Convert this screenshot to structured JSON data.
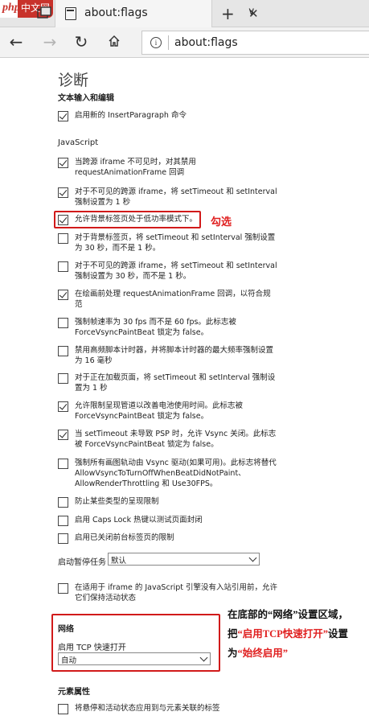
{
  "browser": {
    "logo_text": "php",
    "logo_cn": "中文网",
    "tab_title": "about:flags",
    "tab_close": "✕",
    "new_tab": "+",
    "tab_menu": "∨",
    "address": "about:flags",
    "back": "←",
    "forward": "→",
    "refresh": "↻"
  },
  "page": {
    "heading": "诊断",
    "sections": {
      "text_input": "文本输入和编辑",
      "javascript": "JavaScript",
      "startup_label": "启动暂停任务",
      "network": "网络",
      "tcp_label": "启用 TCP 快速打开",
      "element_props": "元素属性"
    },
    "options": [
      {
        "label": "启用新的 InsertParagraph 命令",
        "checked": true
      },
      {
        "label": "当跨源 iframe 不可见时，对其禁用 requestAnimationFrame 回调",
        "checked": true
      },
      {
        "label": "对于不可见的跨源 iframe，将 setTimeout 和 setInterval 强制设置为 1 秒",
        "checked": true
      },
      {
        "label": "允许背景标签页处于低功率模式下。",
        "checked": true
      },
      {
        "label": "对于背景标签页，将 setTimeout 和 setInterval 强制设置为 30 秒，而不是 1 秒。",
        "checked": false
      },
      {
        "label": "对于不可见的跨源 iframe，将 setTimeout 和 setInterval 强制设置为 30 秒，而不是 1 秒。",
        "checked": false
      },
      {
        "label": "在绘画前处理 requestAnimationFrame 回调，以符合规范",
        "checked": true
      },
      {
        "label": "强制帧速率为 30 fps 而不是 60 fps。此标志被 ForceVsyncPaintBeat 锁定为 false。",
        "checked": false
      },
      {
        "label": "禁用高频脚本计时器，并将脚本计时器的最大频率强制设置为 16 毫秒",
        "checked": false
      },
      {
        "label": "对于正在加载页面，将 setTimeout 和 setInterval 强制设置为 1 秒",
        "checked": false
      },
      {
        "label": "允许限制呈现管道以改善电池使用时间。此标志被 ForceVsyncPaintBeat 锁定为 false。",
        "checked": true
      },
      {
        "label": "当 setTimeout 未导致 PSP 时，允许 Vsync 关闭。此标志被 ForceVsyncPaintBeat 锁定为 false。",
        "checked": true
      },
      {
        "label": "强制所有画图轨动由 Vsync 驱动(如果可用)。此标志将替代 AllowVsyncToTurnOffWhenBeatDidNotPaint、AllowRenderThrottling 和 Use30FPS。",
        "checked": false
      },
      {
        "label": "防止某些类型的呈现限制",
        "checked": false
      },
      {
        "label": "启用 Caps Lock 热键以测试页面封闭",
        "checked": false
      },
      {
        "label": "启用已关闭前台标签页的限制",
        "checked": false
      },
      {
        "label": "在适用于 iframe 的 JavaScript 引擎没有入站引用前，允许它们保持活动状态",
        "checked": false
      },
      {
        "label": "将悬停和活动状态应用到与元素关联的标签",
        "checked": false
      }
    ],
    "startup_value": "默认",
    "tcp_value": "自动"
  },
  "annotations": {
    "check_note": "勾选",
    "note_parts": [
      "在底部的“网络”设置区域，把",
      "“启用TCP快速打开”",
      "设置为",
      "“始终启用”"
    ]
  },
  "colors": {
    "annotation_red": "#d11a1a",
    "logo_red": "#c8322b"
  }
}
